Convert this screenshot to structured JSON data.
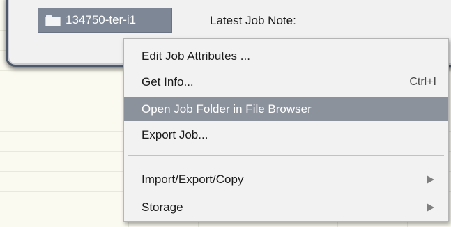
{
  "job_panel": {
    "job_name": "134750-ter-i1",
    "latest_note_label": "Latest Job Note:"
  },
  "context_menu": {
    "items": [
      {
        "label": "Edit Job Attributes ...",
        "shortcut": "",
        "submenu": false,
        "highlighted": false
      },
      {
        "label": "Get Info...",
        "shortcut": "Ctrl+I",
        "submenu": false,
        "highlighted": false
      },
      {
        "label": "Open Job Folder in File Browser",
        "shortcut": "",
        "submenu": false,
        "highlighted": true
      },
      {
        "label": "Export Job...",
        "shortcut": "",
        "submenu": false,
        "highlighted": false
      },
      {
        "label": "Import/Export/Copy",
        "shortcut": "",
        "submenu": true,
        "highlighted": false
      },
      {
        "label": "Storage",
        "shortcut": "",
        "submenu": true,
        "highlighted": false
      }
    ]
  },
  "colors": {
    "highlight": "#8c929c",
    "panel_border": "#4d5868",
    "job_chip": "#7d8796"
  },
  "icons": {
    "job_chip_icon": "folder-icon",
    "submenu_icon": "submenu-arrow-icon"
  }
}
